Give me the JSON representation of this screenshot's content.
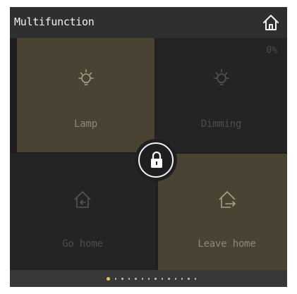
{
  "header": {
    "title": "Multifunction",
    "home_icon": "home-icon"
  },
  "tiles": [
    {
      "label": "Lamp",
      "state": "on",
      "icon": "bulb-icon"
    },
    {
      "label": "Dimming",
      "state": "off",
      "icon": "bulb-icon",
      "value": "0%"
    },
    {
      "label": "Go home",
      "state": "off",
      "icon": "house-arrow-in-icon"
    },
    {
      "label": "Leave home",
      "state": "on",
      "icon": "house-arrow-out-icon"
    }
  ],
  "lock": {
    "icon": "lock-icon"
  },
  "pager": {
    "count": 14,
    "active_index": 0
  },
  "colors": {
    "tile_on": "#4a4232",
    "tile_off": "#242424",
    "accent": "#e6c24f",
    "header": "#2f2f2f"
  }
}
